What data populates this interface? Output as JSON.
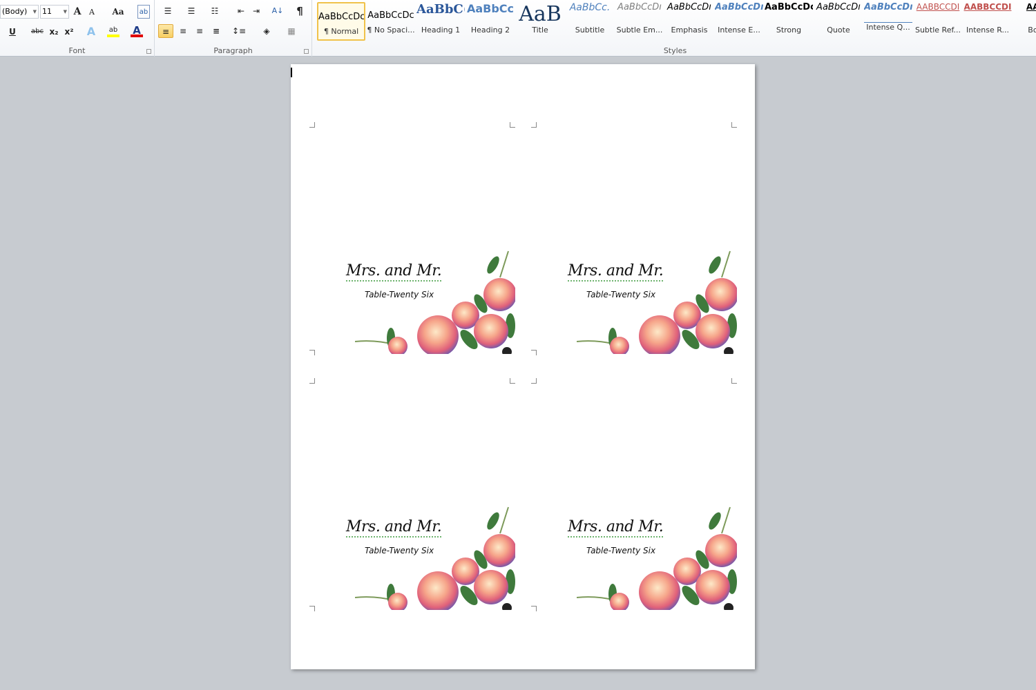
{
  "ribbon": {
    "font": {
      "label": "Font",
      "font_name": "(Body)",
      "font_size": "11",
      "grow": "A",
      "shrink": "A",
      "change_case": "Aa",
      "underline": "U",
      "strike": "abc",
      "subscript": "x₂",
      "superscript": "x²",
      "text_effects": "A",
      "highlight": "ab",
      "font_color": "A",
      "colors": {
        "highlight": "#ffff00",
        "font_color": "#e00000"
      }
    },
    "paragraph": {
      "label": "Paragraph",
      "show_marks": "¶",
      "align_left_active": true
    },
    "styles": {
      "label": "Styles",
      "items": [
        {
          "preview": "AaBbCcDc",
          "name": "¶ Normal",
          "color": "#000000",
          "active": true
        },
        {
          "preview": "AaBbCcDc",
          "name": "¶ No Spaci...",
          "color": "#000000"
        },
        {
          "preview": "AaBbC(",
          "name": "Heading 1",
          "color": "#2b579a"
        },
        {
          "preview": "AaBbCc",
          "name": "Heading 2",
          "color": "#4f81bd"
        },
        {
          "preview": "AaB",
          "name": "Title",
          "color": "#17365d"
        },
        {
          "preview": "AaBbCc.",
          "name": "Subtitle",
          "color": "#4f81bd"
        },
        {
          "preview": "AaBbCcDı",
          "name": "Subtle Em...",
          "color": "#808080"
        },
        {
          "preview": "AaBbCcDı",
          "name": "Emphasis",
          "color": "#000000"
        },
        {
          "preview": "AaBbCcDı",
          "name": "Intense E...",
          "color": "#4f81bd"
        },
        {
          "preview": "AaBbCcDc",
          "name": "Strong",
          "color": "#000000"
        },
        {
          "preview": "AaBbCcDı",
          "name": "Quote",
          "color": "#000000"
        },
        {
          "preview": "AaBbCcDı",
          "name": "Intense Q...",
          "color": "#4f81bd"
        },
        {
          "preview": "AABBCCDI",
          "name": "Subtle Ref...",
          "color": "#c0504d"
        },
        {
          "preview": "AABBCCDI",
          "name": "Intense R...",
          "color": "#c0504d"
        },
        {
          "preview": "AABI",
          "name": "Book",
          "color": "#000000"
        }
      ]
    }
  },
  "cards": [
    {
      "name": "Mrs. and Mr.",
      "table": "Table-Twenty Six"
    },
    {
      "name": "Mrs. and Mr.",
      "table": "Table-Twenty Six"
    },
    {
      "name": "Mrs. and Mr.",
      "table": "Table-Twenty Six"
    },
    {
      "name": "Mrs. and Mr.",
      "table": "Table-Twenty Six"
    }
  ]
}
